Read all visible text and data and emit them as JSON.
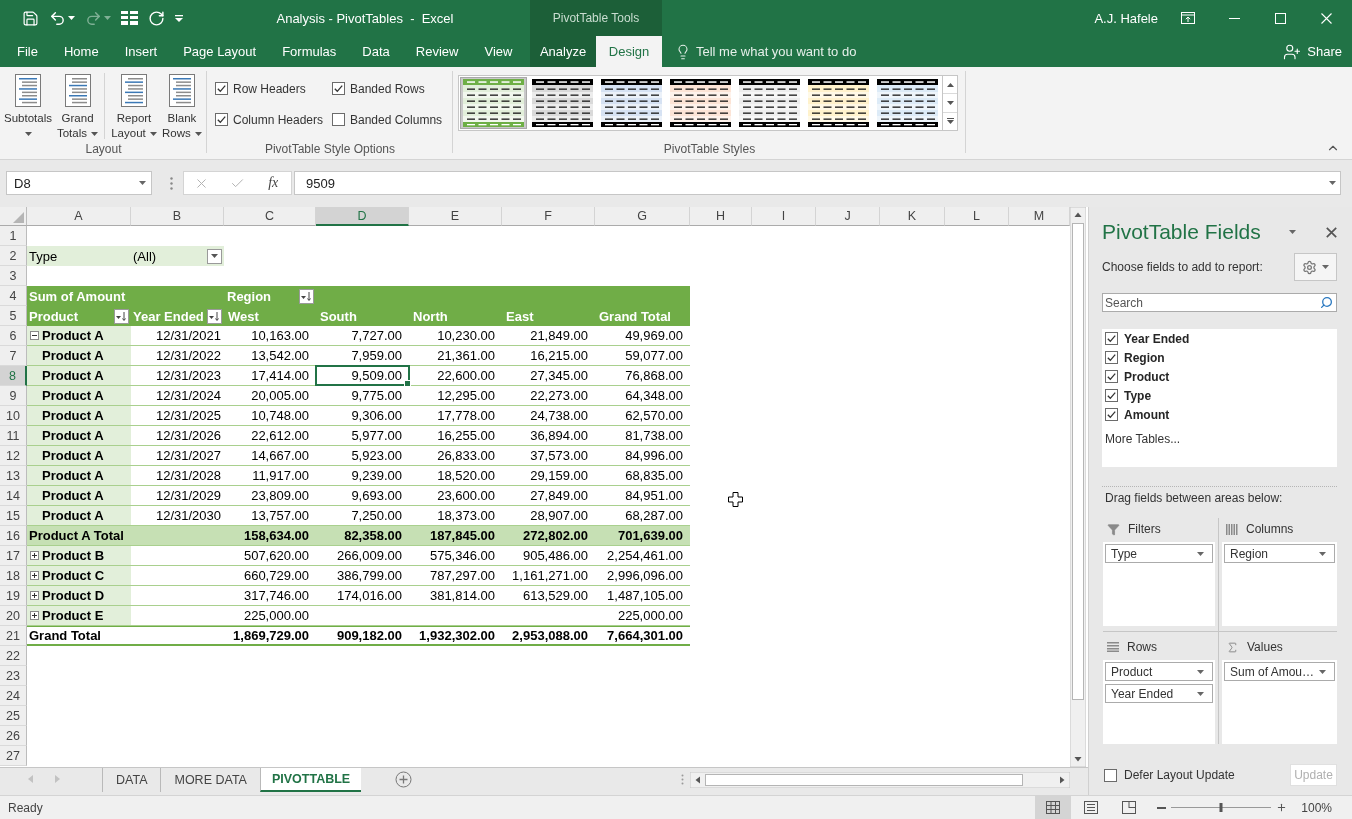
{
  "window": {
    "title": "Analysis - PivotTables  -  Excel",
    "context_title": "PivotTable Tools",
    "user": "A.J. Hafele"
  },
  "quick_access": [
    {
      "kind": "save",
      "disabled": false
    },
    {
      "kind": "undo",
      "disabled": false
    },
    {
      "kind": "redo",
      "disabled": true
    },
    {
      "kind": "form",
      "disabled": false
    },
    {
      "kind": "refresh",
      "disabled": false
    },
    {
      "kind": "customize",
      "disabled": false
    }
  ],
  "ribbon_tabs": [
    {
      "label": "File",
      "selected": false,
      "contextual": false
    },
    {
      "label": "Home",
      "selected": false,
      "contextual": false
    },
    {
      "label": "Insert",
      "selected": false,
      "contextual": false
    },
    {
      "label": "Page Layout",
      "selected": false,
      "contextual": false
    },
    {
      "label": "Formulas",
      "selected": false,
      "contextual": false
    },
    {
      "label": "Data",
      "selected": false,
      "contextual": false
    },
    {
      "label": "Review",
      "selected": false,
      "contextual": false
    },
    {
      "label": "View",
      "selected": false,
      "contextual": false
    },
    {
      "label": "Analyze",
      "selected": false,
      "contextual": true
    },
    {
      "label": "Design",
      "selected": true,
      "contextual": true
    }
  ],
  "tell_me": {
    "placeholder": "Tell me what you want to do"
  },
  "share_button": "Share",
  "ribbon": {
    "layout_group": {
      "label": "Layout",
      "button_sets": [
        [
          "Subtotals",
          "Grand Totals"
        ],
        [
          "Report Layout",
          "Blank Rows"
        ]
      ]
    },
    "style_options_group": {
      "label": "PivotTable Style Options",
      "options": [
        {
          "label": "Row Headers",
          "checked": true
        },
        {
          "label": "Banded Rows",
          "checked": true
        },
        {
          "label": "Column Headers",
          "checked": true
        },
        {
          "label": "Banded Columns",
          "checked": false
        }
      ]
    },
    "styles_group": {
      "label": "PivotTable Styles",
      "styles": [
        {
          "color": "#e2efda",
          "kind": "accent",
          "selected": true
        },
        {
          "color": "#d9d9d9",
          "kind": "dark",
          "selected": false
        },
        {
          "color": "#d6e2f3",
          "kind": "dark",
          "selected": false
        },
        {
          "color": "#fce4d6",
          "kind": "dark",
          "selected": false
        },
        {
          "color": "#ededed",
          "kind": "dark",
          "selected": false
        },
        {
          "color": "#fff2cc",
          "kind": "dark",
          "selected": false
        },
        {
          "color": "#ddebf7",
          "kind": "dark",
          "selected": false
        }
      ]
    }
  },
  "formula_bar": {
    "name_box": "D8",
    "edit_buttons": [
      {
        "kind": "cancel",
        "disabled": true
      },
      {
        "kind": "enter",
        "disabled": true
      }
    ],
    "function_button": "fx",
    "value": "9509"
  },
  "sheet": {
    "columns": [
      {
        "label": "A",
        "selected": false
      },
      {
        "label": "B",
        "selected": false
      },
      {
        "label": "C",
        "selected": false
      },
      {
        "label": "D",
        "selected": true
      },
      {
        "label": "E",
        "selected": false
      },
      {
        "label": "F",
        "selected": false
      },
      {
        "label": "G",
        "selected": false
      },
      {
        "label": "H",
        "selected": false
      },
      {
        "label": "I",
        "selected": false
      },
      {
        "label": "J",
        "selected": false
      },
      {
        "label": "K",
        "selected": false
      },
      {
        "label": "L",
        "selected": false
      },
      {
        "label": "M",
        "selected": false
      }
    ],
    "rows": [
      {
        "label": "1",
        "selected": false
      },
      {
        "label": "2",
        "selected": false
      },
      {
        "label": "3",
        "selected": false
      },
      {
        "label": "4",
        "selected": false
      },
      {
        "label": "5",
        "selected": false
      },
      {
        "label": "6",
        "selected": false
      },
      {
        "label": "7",
        "selected": false
      },
      {
        "label": "8",
        "selected": true
      },
      {
        "label": "9",
        "selected": false
      },
      {
        "label": "10",
        "selected": false
      },
      {
        "label": "11",
        "selected": false
      },
      {
        "label": "12",
        "selected": false
      },
      {
        "label": "13",
        "selected": false
      },
      {
        "label": "14",
        "selected": false
      },
      {
        "label": "15",
        "selected": false
      },
      {
        "label": "16",
        "selected": false
      },
      {
        "label": "17",
        "selected": false
      },
      {
        "label": "18",
        "selected": false
      },
      {
        "label": "19",
        "selected": false
      },
      {
        "label": "20",
        "selected": false
      },
      {
        "label": "21",
        "selected": false
      },
      {
        "label": "22",
        "selected": false
      },
      {
        "label": "23",
        "selected": false
      },
      {
        "label": "24",
        "selected": false
      },
      {
        "label": "25",
        "selected": false
      },
      {
        "label": "26",
        "selected": false
      },
      {
        "label": "27",
        "selected": false
      }
    ],
    "report_filter": {
      "field": "Type",
      "value": "(All)"
    },
    "pivot": {
      "data_field": "Sum of Amount",
      "column_field": "Region",
      "row_fields": [
        "Product",
        "Year Ended"
      ],
      "column_items": [
        "West",
        "South",
        "North",
        "East"
      ],
      "grand_total_column": "Grand Total",
      "groups": [
        {
          "expanded": true,
          "rows": [
            {
              "label": "Product A",
              "year": "12/31/2021",
              "values": [
                "10,163.00",
                "7,727.00",
                "10,230.00",
                "21,849.00"
              ],
              "row_total": "49,969.00"
            },
            {
              "label": "Product A",
              "year": "12/31/2022",
              "values": [
                "13,542.00",
                "7,959.00",
                "21,361.00",
                "16,215.00"
              ],
              "row_total": "59,077.00"
            },
            {
              "label": "Product A",
              "year": "12/31/2023",
              "values": [
                "17,414.00",
                "9,509.00",
                "22,600.00",
                "27,345.00"
              ],
              "row_total": "76,868.00"
            },
            {
              "label": "Product A",
              "year": "12/31/2024",
              "values": [
                "20,005.00",
                "9,775.00",
                "12,295.00",
                "22,273.00"
              ],
              "row_total": "64,348.00"
            },
            {
              "label": "Product A",
              "year": "12/31/2025",
              "values": [
                "10,748.00",
                "9,306.00",
                "17,778.00",
                "24,738.00"
              ],
              "row_total": "62,570.00"
            },
            {
              "label": "Product A",
              "year": "12/31/2026",
              "values": [
                "22,612.00",
                "5,977.00",
                "16,255.00",
                "36,894.00"
              ],
              "row_total": "81,738.00"
            },
            {
              "label": "Product A",
              "year": "12/31/2027",
              "values": [
                "14,667.00",
                "5,923.00",
                "26,833.00",
                "37,573.00"
              ],
              "row_total": "84,996.00"
            },
            {
              "label": "Product A",
              "year": "12/31/2028",
              "values": [
                "11,917.00",
                "9,239.00",
                "18,520.00",
                "29,159.00"
              ],
              "row_total": "68,835.00"
            },
            {
              "label": "Product A",
              "year": "12/31/2029",
              "values": [
                "23,809.00",
                "9,693.00",
                "23,600.00",
                "27,849.00"
              ],
              "row_total": "84,951.00"
            },
            {
              "label": "Product A",
              "year": "12/31/2030",
              "values": [
                "13,757.00",
                "7,250.00",
                "18,373.00",
                "28,907.00"
              ],
              "row_total": "68,287.00"
            }
          ],
          "total": {
            "label": "Product A Total",
            "values": [
              "158,634.00",
              "82,358.00",
              "187,845.00",
              "272,802.00"
            ],
            "row_total": "701,639.00"
          }
        },
        {
          "expanded": false,
          "label": "Product B",
          "values": [
            "507,620.00",
            "266,009.00",
            "575,346.00",
            "905,486.00"
          ],
          "row_total": "2,254,461.00"
        },
        {
          "expanded": false,
          "label": "Product C",
          "values": [
            "660,729.00",
            "386,799.00",
            "787,297.00",
            "1,161,271.00"
          ],
          "row_total": "2,996,096.00"
        },
        {
          "expanded": false,
          "label": "Product D",
          "values": [
            "317,746.00",
            "174,016.00",
            "381,814.00",
            "613,529.00"
          ],
          "row_total": "1,487,105.00"
        },
        {
          "expanded": false,
          "label": "Product E",
          "values": [
            "225,000.00"
          ],
          "row_total": "225,000.00"
        }
      ],
      "grand_total": {
        "label": "Grand Total",
        "values": [
          "1,869,729.00",
          "909,182.00",
          "1,932,302.00",
          "2,953,088.00"
        ],
        "row_total": "7,664,301.00"
      }
    }
  },
  "sheet_nav": [
    {
      "kind": "previous",
      "disabled": true
    },
    {
      "kind": "next",
      "disabled": true
    }
  ],
  "sheet_tabs": [
    {
      "label": "DATA",
      "selected": false
    },
    {
      "label": "MORE DATA",
      "selected": false
    },
    {
      "label": "PIVOTTABLE",
      "selected": true
    }
  ],
  "field_pane": {
    "title": "PivotTable Fields",
    "prompt": "Choose fields to add to report:",
    "search": {
      "placeholder": "Search"
    },
    "fields": [
      {
        "label": "Year Ended",
        "checked": true
      },
      {
        "label": "Region",
        "checked": true
      },
      {
        "label": "Product",
        "checked": true
      },
      {
        "label": "Type",
        "checked": true
      },
      {
        "label": "Amount",
        "checked": true
      }
    ],
    "more_tables": "More Tables...",
    "areas_prompt": "Drag fields between areas below:",
    "areas": [
      {
        "kind": "filters",
        "label": "Filters",
        "items": [
          "Type"
        ]
      },
      {
        "kind": "columns",
        "label": "Columns",
        "items": [
          "Region"
        ]
      },
      {
        "kind": "rows",
        "label": "Rows",
        "items": [
          "Product",
          "Year Ended"
        ]
      },
      {
        "kind": "values",
        "label": "Values",
        "items": [
          "Sum of Amou…"
        ]
      }
    ],
    "defer_update": {
      "label": "Defer Layout Update",
      "checked": false
    },
    "update_button": {
      "label": "Update",
      "disabled": true
    }
  },
  "status_bar": {
    "status": "Ready",
    "views": [
      {
        "kind": "normal",
        "selected": true
      },
      {
        "kind": "page_layout",
        "selected": false
      },
      {
        "kind": "page_break",
        "selected": false
      }
    ],
    "zoom": {
      "level": 0.5,
      "reading": "100%"
    }
  }
}
